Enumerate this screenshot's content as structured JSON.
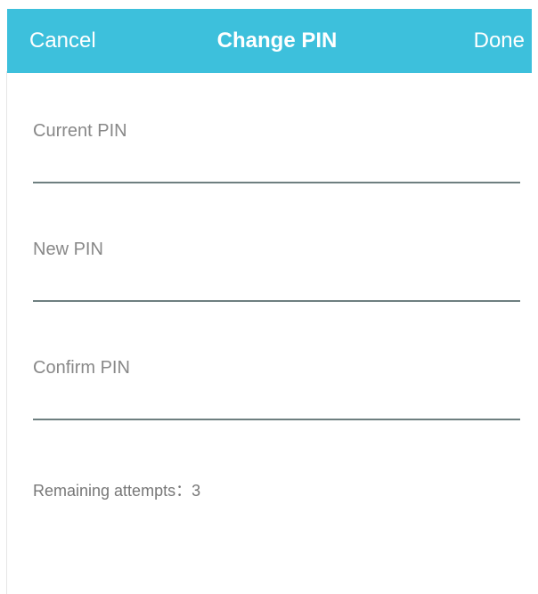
{
  "header": {
    "cancel_label": "Cancel",
    "title": "Change PIN",
    "done_label": "Done",
    "bg_color": "#3dc0dc"
  },
  "form": {
    "fields": [
      {
        "label": "Current PIN",
        "value": ""
      },
      {
        "label": "New PIN",
        "value": ""
      },
      {
        "label": "Confirm PIN",
        "value": ""
      }
    ]
  },
  "status": {
    "remaining_label": "Remaining attempts：3"
  }
}
